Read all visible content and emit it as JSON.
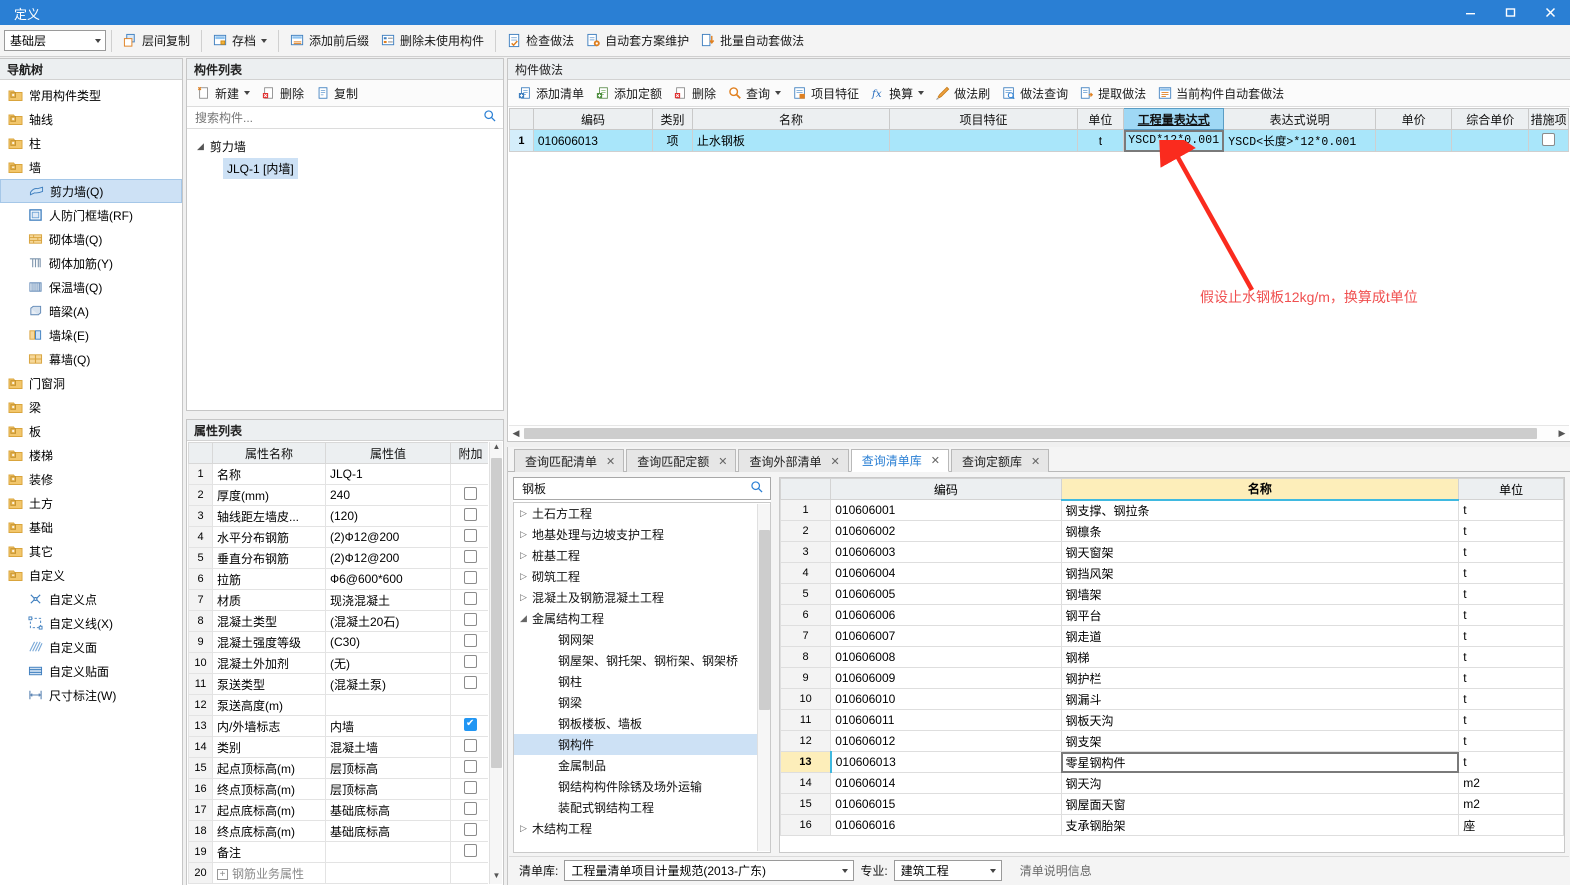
{
  "window": {
    "title": "定义",
    "controls": {
      "minimize": "—",
      "maximize": "❐",
      "close": "✕"
    }
  },
  "toolbar": {
    "floor_select": "基础层",
    "buttons": [
      {
        "label": "层间复制",
        "icon": "copy-between-floors-icon",
        "caret": false
      },
      {
        "label": "存档",
        "icon": "archive-icon",
        "caret": true
      },
      {
        "label": "添加前后缀",
        "icon": "add-affix-icon",
        "caret": false
      },
      {
        "label": "删除未使用构件",
        "icon": "delete-unused-icon",
        "caret": false
      },
      {
        "label": "检查做法",
        "icon": "check-method-icon",
        "caret": false
      },
      {
        "label": "自动套方案维护",
        "icon": "auto-scheme-icon",
        "caret": false
      },
      {
        "label": "批量自动套做法",
        "icon": "batch-auto-icon",
        "caret": false
      }
    ]
  },
  "nav": {
    "title": "导航树",
    "items": [
      {
        "label": "常用构件类型",
        "icon": "folder-plus-icon",
        "level": 0,
        "selected": false
      },
      {
        "label": "轴线",
        "icon": "folder-plus-icon",
        "level": 0,
        "selected": false
      },
      {
        "label": "柱",
        "icon": "folder-plus-icon",
        "level": 0,
        "selected": false
      },
      {
        "label": "墙",
        "icon": "folder-open-icon",
        "level": 0,
        "selected": false
      },
      {
        "label": "剪力墙(Q)",
        "icon": "shear-wall-icon",
        "level": 1,
        "selected": true
      },
      {
        "label": "人防门框墙(RF)",
        "icon": "door-frame-wall-icon",
        "level": 1,
        "selected": false
      },
      {
        "label": "砌体墙(Q)",
        "icon": "masonry-wall-icon",
        "level": 1,
        "selected": false
      },
      {
        "label": "砌体加筋(Y)",
        "icon": "masonry-reinforce-icon",
        "level": 1,
        "selected": false
      },
      {
        "label": "保温墙(Q)",
        "icon": "insulation-wall-icon",
        "level": 1,
        "selected": false
      },
      {
        "label": "暗梁(A)",
        "icon": "hidden-beam-icon",
        "level": 1,
        "selected": false
      },
      {
        "label": "墙垛(E)",
        "icon": "wall-pier-icon",
        "level": 1,
        "selected": false
      },
      {
        "label": "幕墙(Q)",
        "icon": "curtain-wall-icon",
        "level": 1,
        "selected": false
      },
      {
        "label": "门窗洞",
        "icon": "folder-plus-icon",
        "level": 0,
        "selected": false
      },
      {
        "label": "梁",
        "icon": "folder-plus-icon",
        "level": 0,
        "selected": false
      },
      {
        "label": "板",
        "icon": "folder-plus-icon",
        "level": 0,
        "selected": false
      },
      {
        "label": "楼梯",
        "icon": "folder-plus-icon",
        "level": 0,
        "selected": false
      },
      {
        "label": "装修",
        "icon": "folder-plus-icon",
        "level": 0,
        "selected": false
      },
      {
        "label": "土方",
        "icon": "folder-plus-icon",
        "level": 0,
        "selected": false
      },
      {
        "label": "基础",
        "icon": "folder-plus-icon",
        "level": 0,
        "selected": false
      },
      {
        "label": "其它",
        "icon": "folder-plus-icon",
        "level": 0,
        "selected": false
      },
      {
        "label": "自定义",
        "icon": "folder-open-icon",
        "level": 0,
        "selected": false
      },
      {
        "label": "自定义点",
        "icon": "custom-point-icon",
        "level": 1,
        "selected": false
      },
      {
        "label": "自定义线(X)",
        "icon": "custom-line-icon",
        "level": 1,
        "selected": false
      },
      {
        "label": "自定义面",
        "icon": "custom-face-icon",
        "level": 1,
        "selected": false
      },
      {
        "label": "自定义贴面",
        "icon": "custom-veneer-icon",
        "level": 1,
        "selected": false
      },
      {
        "label": "尺寸标注(W)",
        "icon": "dimension-icon",
        "level": 1,
        "selected": false
      }
    ]
  },
  "component_list": {
    "title": "构件列表",
    "buttons": [
      {
        "label": "新建",
        "icon": "new-icon",
        "caret": true
      },
      {
        "label": "删除",
        "icon": "delete-icon",
        "caret": false
      },
      {
        "label": "复制",
        "icon": "copy-icon",
        "caret": false
      }
    ],
    "search_placeholder": "搜索构件...",
    "group": "剪力墙",
    "item": "JLQ-1 [内墙]"
  },
  "property_list": {
    "title": "属性列表",
    "columns": [
      "",
      "属性名称",
      "属性值",
      "附加"
    ],
    "rows": [
      {
        "n": "1",
        "name": "名称",
        "value": "JLQ-1",
        "blue": true,
        "check": null
      },
      {
        "n": "2",
        "name": "厚度(mm)",
        "value": "240",
        "blue": true,
        "check": false
      },
      {
        "n": "3",
        "name": "轴线距左墙皮...",
        "value": "(120)",
        "blue": false,
        "check": false
      },
      {
        "n": "4",
        "name": "水平分布钢筋",
        "value": "(2)Ф12@200",
        "blue": true,
        "check": false
      },
      {
        "n": "5",
        "name": "垂直分布钢筋",
        "value": "(2)Ф12@200",
        "blue": true,
        "check": false
      },
      {
        "n": "6",
        "name": "拉筋",
        "value": "Ф6@600*600",
        "blue": true,
        "check": false
      },
      {
        "n": "7",
        "name": "材质",
        "value": "现浇混凝土",
        "blue": false,
        "check": false
      },
      {
        "n": "8",
        "name": "混凝土类型",
        "value": "(混凝土20石)",
        "blue": true,
        "check": false
      },
      {
        "n": "9",
        "name": "混凝土强度等级",
        "value": "(C30)",
        "blue": true,
        "check": false
      },
      {
        "n": "10",
        "name": "混凝土外加剂",
        "value": "(无)",
        "blue": true,
        "check": false
      },
      {
        "n": "11",
        "name": "泵送类型",
        "value": "(混凝土泵)",
        "blue": true,
        "check": false
      },
      {
        "n": "12",
        "name": "泵送高度(m)",
        "value": "",
        "blue": false,
        "check": null
      },
      {
        "n": "13",
        "name": "内/外墙标志",
        "value": "内墙",
        "blue": true,
        "check": true
      },
      {
        "n": "14",
        "name": "类别",
        "value": "混凝土墙",
        "blue": true,
        "check": false
      },
      {
        "n": "15",
        "name": "起点顶标高(m)",
        "value": "层顶标高",
        "blue": false,
        "check": false
      },
      {
        "n": "16",
        "name": "终点顶标高(m)",
        "value": "层顶标高",
        "blue": false,
        "check": false
      },
      {
        "n": "17",
        "name": "起点底标高(m)",
        "value": "基础底标高",
        "blue": false,
        "check": false
      },
      {
        "n": "18",
        "name": "终点底标高(m)",
        "value": "基础底标高",
        "blue": false,
        "check": false
      },
      {
        "n": "19",
        "name": "备注",
        "value": "",
        "blue": false,
        "check": false
      },
      {
        "n": "20",
        "name": "钢筋业务属性",
        "value": "",
        "blue": false,
        "check": null,
        "expander": "+"
      }
    ]
  },
  "method_panel": {
    "title": "构件做法",
    "buttons": [
      {
        "label": "添加清单",
        "icon": "add-list-icon",
        "caret": false
      },
      {
        "label": "添加定额",
        "icon": "add-quota-icon",
        "caret": false
      },
      {
        "label": "删除",
        "icon": "delete-icon",
        "caret": false
      },
      {
        "label": "查询",
        "icon": "query-icon",
        "caret": true
      },
      {
        "label": "项目特征",
        "icon": "project-feature-icon",
        "caret": false
      },
      {
        "label": "换算",
        "icon": "convert-icon",
        "caret": true
      },
      {
        "label": "做法刷",
        "icon": "method-brush-icon",
        "caret": false
      },
      {
        "label": "做法查询",
        "icon": "method-query-icon",
        "caret": false
      },
      {
        "label": "提取做法",
        "icon": "extract-method-icon",
        "caret": false
      },
      {
        "label": "当前构件自动套做法",
        "icon": "auto-apply-icon",
        "caret": false
      }
    ],
    "columns": [
      "",
      "编码",
      "类别",
      "名称",
      "项目特征",
      "单位",
      "工程量表达式",
      "表达式说明",
      "单价",
      "综合单价",
      "措施项"
    ],
    "selected_column": "工程量表达式",
    "rows": [
      {
        "n": "1",
        "code": "010606013",
        "category": "项",
        "name": "止水钢板",
        "feature": "",
        "unit": "t",
        "expression": "YSCD*12*0.001",
        "expression_desc": "YSCD<长度>*12*0.001",
        "unit_price": "",
        "comprehensive_price": "",
        "measure_item": false
      }
    ]
  },
  "annotation": {
    "text": "假设止水钢板12kg/m，换算成t单位",
    "color": "#f05050"
  },
  "query_panel": {
    "tabs": [
      {
        "label": "查询匹配清单",
        "active": false
      },
      {
        "label": "查询匹配定额",
        "active": false
      },
      {
        "label": "查询外部清单",
        "active": false
      },
      {
        "label": "查询清单库",
        "active": true
      },
      {
        "label": "查询定额库",
        "active": false
      }
    ],
    "search_value": "钢板",
    "tree": [
      {
        "label": "土石方工程",
        "level": 1,
        "expander": "▷",
        "selected": false
      },
      {
        "label": "地基处理与边坡支护工程",
        "level": 1,
        "expander": "▷",
        "selected": false
      },
      {
        "label": "桩基工程",
        "level": 1,
        "expander": "▷",
        "selected": false
      },
      {
        "label": "砌筑工程",
        "level": 1,
        "expander": "▷",
        "selected": false
      },
      {
        "label": "混凝土及钢筋混凝土工程",
        "level": 1,
        "expander": "▷",
        "selected": false
      },
      {
        "label": "金属结构工程",
        "level": 1,
        "expander": "◢",
        "selected": false
      },
      {
        "label": "钢网架",
        "level": 2,
        "expander": "",
        "selected": false
      },
      {
        "label": "钢屋架、钢托架、钢桁架、钢架桥",
        "level": 2,
        "expander": "",
        "selected": false
      },
      {
        "label": "钢柱",
        "level": 2,
        "expander": "",
        "selected": false
      },
      {
        "label": "钢梁",
        "level": 2,
        "expander": "",
        "selected": false
      },
      {
        "label": "钢板楼板、墙板",
        "level": 2,
        "expander": "",
        "selected": false
      },
      {
        "label": "钢构件",
        "level": 2,
        "expander": "",
        "selected": true
      },
      {
        "label": "金属制品",
        "level": 2,
        "expander": "",
        "selected": false
      },
      {
        "label": "钢结构构件除锈及场外运输",
        "level": 2,
        "expander": "",
        "selected": false
      },
      {
        "label": "装配式钢结构工程",
        "level": 2,
        "expander": "",
        "selected": false
      },
      {
        "label": "木结构工程",
        "level": 1,
        "expander": "▷",
        "selected": false
      }
    ],
    "table": {
      "columns": [
        "",
        "编码",
        "名称",
        "单位"
      ],
      "highlight_column": "名称",
      "rows": [
        {
          "n": "1",
          "code": "010606001",
          "name": "钢支撑、钢拉条",
          "unit": "t",
          "selected": false
        },
        {
          "n": "2",
          "code": "010606002",
          "name": "钢檩条",
          "unit": "t",
          "selected": false
        },
        {
          "n": "3",
          "code": "010606003",
          "name": "钢天窗架",
          "unit": "t",
          "selected": false
        },
        {
          "n": "4",
          "code": "010606004",
          "name": "钢挡风架",
          "unit": "t",
          "selected": false
        },
        {
          "n": "5",
          "code": "010606005",
          "name": "钢墙架",
          "unit": "t",
          "selected": false
        },
        {
          "n": "6",
          "code": "010606006",
          "name": "钢平台",
          "unit": "t",
          "selected": false
        },
        {
          "n": "7",
          "code": "010606007",
          "name": "钢走道",
          "unit": "t",
          "selected": false
        },
        {
          "n": "8",
          "code": "010606008",
          "name": "钢梯",
          "unit": "t",
          "selected": false
        },
        {
          "n": "9",
          "code": "010606009",
          "name": "钢护栏",
          "unit": "t",
          "selected": false
        },
        {
          "n": "10",
          "code": "010606010",
          "name": "钢漏斗",
          "unit": "t",
          "selected": false
        },
        {
          "n": "11",
          "code": "010606011",
          "name": "钢板天沟",
          "unit": "t",
          "selected": false
        },
        {
          "n": "12",
          "code": "010606012",
          "name": "钢支架",
          "unit": "t",
          "selected": false
        },
        {
          "n": "13",
          "code": "010606013",
          "name": "零星钢构件",
          "unit": "t",
          "selected": true
        },
        {
          "n": "14",
          "code": "010606014",
          "name": "钢天沟",
          "unit": "m2",
          "selected": false
        },
        {
          "n": "15",
          "code": "010606015",
          "name": "钢屋面天窗",
          "unit": "m2",
          "selected": false
        },
        {
          "n": "16",
          "code": "010606016",
          "name": "支承钢胎架",
          "unit": "座",
          "selected": false
        }
      ]
    },
    "status": {
      "library_label": "清单库:",
      "library_value": "工程量清单项目计量规范(2013-广东)",
      "major_label": "专业:",
      "major_value": "建筑工程",
      "info": "清单说明信息"
    }
  }
}
